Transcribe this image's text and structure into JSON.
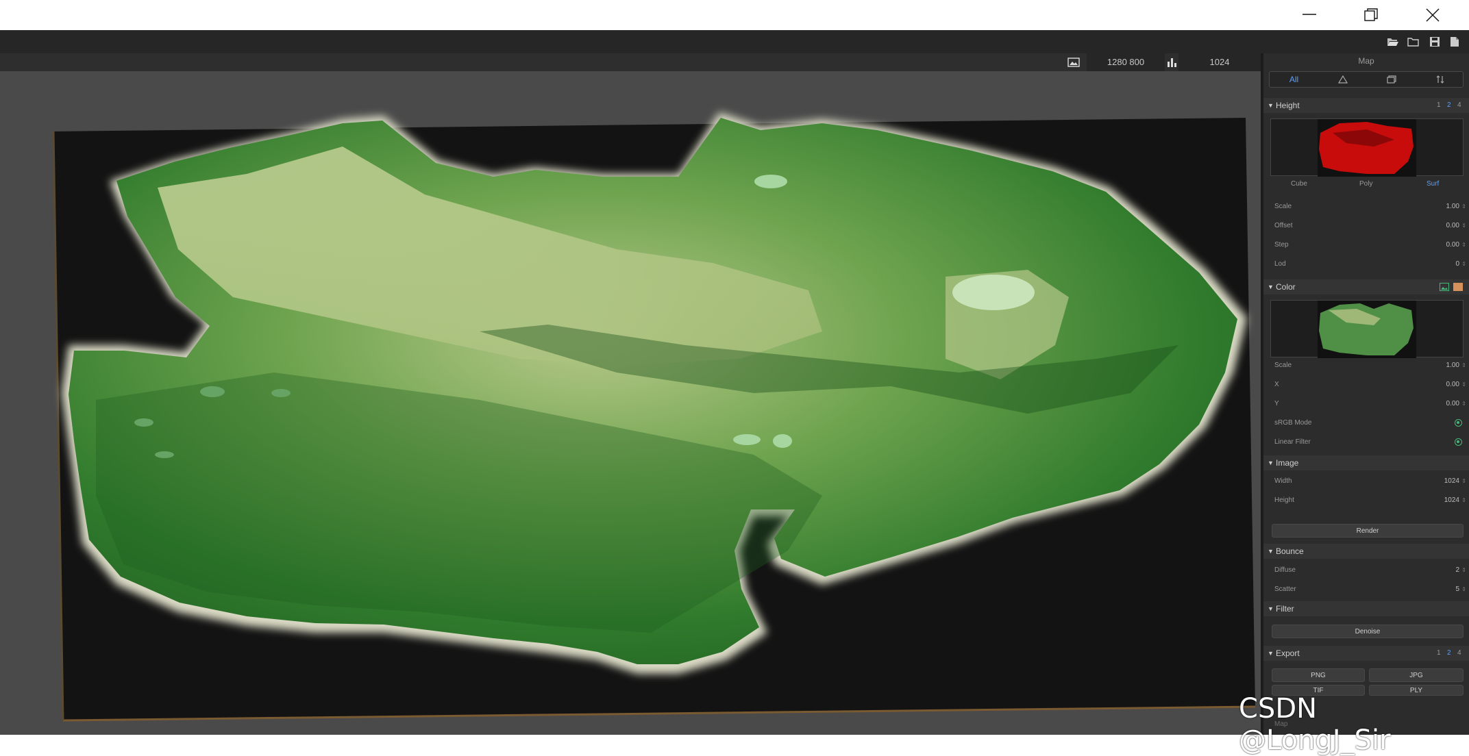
{
  "titlebar": {
    "minimize": "minimize",
    "maximize": "maximize",
    "close": "close"
  },
  "toolbar": {
    "icons": [
      "open-file-icon",
      "open-folder-icon",
      "save-icon",
      "new-file-icon"
    ]
  },
  "viewbar": {
    "resolution": "1280  800",
    "samples": "1024"
  },
  "panel": {
    "title": "Map",
    "tabs": {
      "all": "All"
    },
    "height": {
      "header": "Height",
      "levels": [
        "1",
        "2",
        "4"
      ],
      "active_level": "2",
      "modes": [
        "Cube",
        "Poly",
        "Surf"
      ],
      "active_mode": "Surf",
      "rows": [
        {
          "label": "Scale",
          "value": "1.00"
        },
        {
          "label": "Offset",
          "value": "0.00"
        },
        {
          "label": "Step",
          "value": "0.00"
        },
        {
          "label": "Lod",
          "value": "0"
        }
      ]
    },
    "color": {
      "header": "Color",
      "rows": [
        {
          "label": "Scale",
          "value": "1.00"
        },
        {
          "label": "X",
          "value": "0.00"
        },
        {
          "label": "Y",
          "value": "0.00"
        }
      ],
      "srgb": "sRGB Mode",
      "linear": "Linear Filter"
    },
    "image": {
      "header": "Image",
      "rows": [
        {
          "label": "Width",
          "value": "1024"
        },
        {
          "label": "Height",
          "value": "1024"
        }
      ],
      "render": "Render"
    },
    "bounce": {
      "header": "Bounce",
      "rows": [
        {
          "label": "Diffuse",
          "value": "2"
        },
        {
          "label": "Scatter",
          "value": "5"
        }
      ]
    },
    "filter": {
      "header": "Filter",
      "denoise": "Denoise"
    },
    "export": {
      "header": "Export",
      "levels": [
        "1",
        "2",
        "4"
      ],
      "active_level": "2",
      "buttons": [
        "PNG",
        "JPG",
        "TIF",
        "PLY"
      ],
      "partial_label": "Map"
    }
  },
  "watermark": "CSDN @LongJ_Sir",
  "colors": {
    "accent": "#5aa0ff",
    "green": "#46b97a",
    "terrain": "#2f7a2c",
    "height_map": "#c80c0c"
  }
}
